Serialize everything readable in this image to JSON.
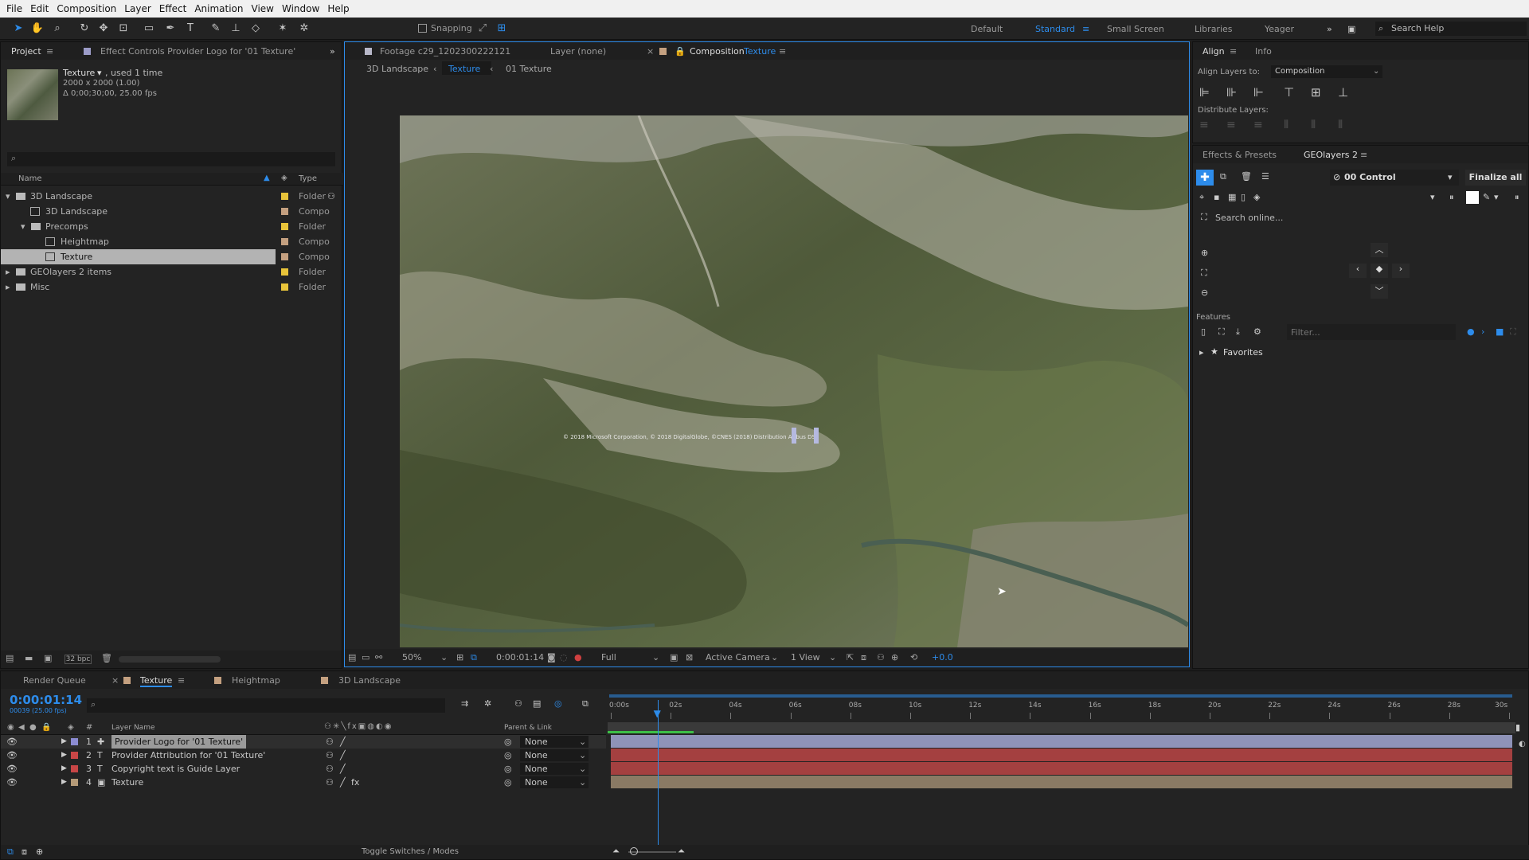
{
  "menu": [
    "File",
    "Edit",
    "Composition",
    "Layer",
    "Effect",
    "Animation",
    "View",
    "Window",
    "Help"
  ],
  "toolbar": {
    "snapping_label": "Snapping",
    "workspaces": [
      "Default",
      "Standard",
      "Small Screen",
      "Libraries",
      "Yeager"
    ],
    "active_workspace": "Standard",
    "search_help_placeholder": "Search Help"
  },
  "project_panel": {
    "tab_project": "Project",
    "tab_effect_controls": "Effect Controls Provider Logo for '01 Texture'",
    "item_name": "Texture",
    "item_used": ", used 1 time",
    "item_size": "2000 x 2000 (1.00)",
    "item_duration": "Δ 0;00;30;00, 25.00 fps",
    "col_name": "Name",
    "col_type": "Type",
    "bpc": "32 bpc",
    "rows": [
      {
        "name": "3D Landscape",
        "type": "Folder"
      },
      {
        "name": "3D Landscape",
        "type": "Compo"
      },
      {
        "name": "Precomps",
        "type": "Folder"
      },
      {
        "name": "Heightmap",
        "type": "Compo"
      },
      {
        "name": "Texture",
        "type": "Compo"
      },
      {
        "name": "GEOlayers 2 items",
        "type": "Folder"
      },
      {
        "name": "Misc",
        "type": "Folder"
      }
    ]
  },
  "viewer": {
    "tab_footage": "Footage c29_1202300222121",
    "tab_layer": "Layer (none)",
    "tab_comp_prefix": "Composition",
    "tab_comp_name": "Texture",
    "crumbs": [
      "3D Landscape",
      "Texture",
      "01 Texture"
    ],
    "copyright": "© 2018 Microsoft Corporation, © 2018 DigitalGlobe, ©CNES (2018) Distribution Airbus DS",
    "zoom": "50%",
    "timecode": "0:00:01:14",
    "resolution": "Full",
    "camera": "Active Camera",
    "views": "1 View",
    "exposure": "+0.0"
  },
  "align_panel": {
    "tab_align": "Align",
    "tab_info": "Info",
    "align_to_label": "Align Layers to:",
    "align_to_value": "Composition",
    "distribute_label": "Distribute Layers:"
  },
  "geolayers": {
    "tab_effects": "Effects & Presets",
    "tab_geo": "GEOlayers 2",
    "control": "00 Control",
    "finalize": "Finalize all",
    "search_online": "Search online...",
    "features_label": "Features",
    "filter_placeholder": "Filter...",
    "favorites": "Favorites"
  },
  "timeline": {
    "tab_render": "Render Queue",
    "tab_texture": "Texture",
    "tab_heightmap": "Heightmap",
    "tab_landscape": "3D Landscape",
    "timecode": "0:00:01:14",
    "frame_info": "00039 (25.00 fps)",
    "col_layer_name": "Layer Name",
    "col_parent": "Parent & Link",
    "toggle_label": "Toggle Switches / Modes",
    "ruler": [
      "0:00s",
      "02s",
      "04s",
      "06s",
      "08s",
      "10s",
      "12s",
      "14s",
      "16s",
      "18s",
      "20s",
      "22s",
      "24s",
      "26s",
      "28s",
      "30s"
    ],
    "playhead_seconds": 1.56,
    "duration_seconds": 30,
    "layers": [
      {
        "num": "1",
        "name": "Provider Logo for '01 Texture'",
        "parent": "None",
        "color": "#8c8cd2",
        "bar": "#8f93b8",
        "type": "shape"
      },
      {
        "num": "2",
        "name": "Provider Attribution for '01 Texture'",
        "parent": "None",
        "color": "#c84646",
        "bar": "#a44040",
        "type": "text"
      },
      {
        "num": "3",
        "name": "Copyright text is Guide Layer",
        "parent": "None",
        "color": "#c84646",
        "bar": "#a44040",
        "type": "text"
      },
      {
        "num": "4",
        "name": "Texture",
        "parent": "None",
        "color": "#b59a78",
        "bar": "#8a7a64",
        "type": "comp"
      }
    ]
  }
}
